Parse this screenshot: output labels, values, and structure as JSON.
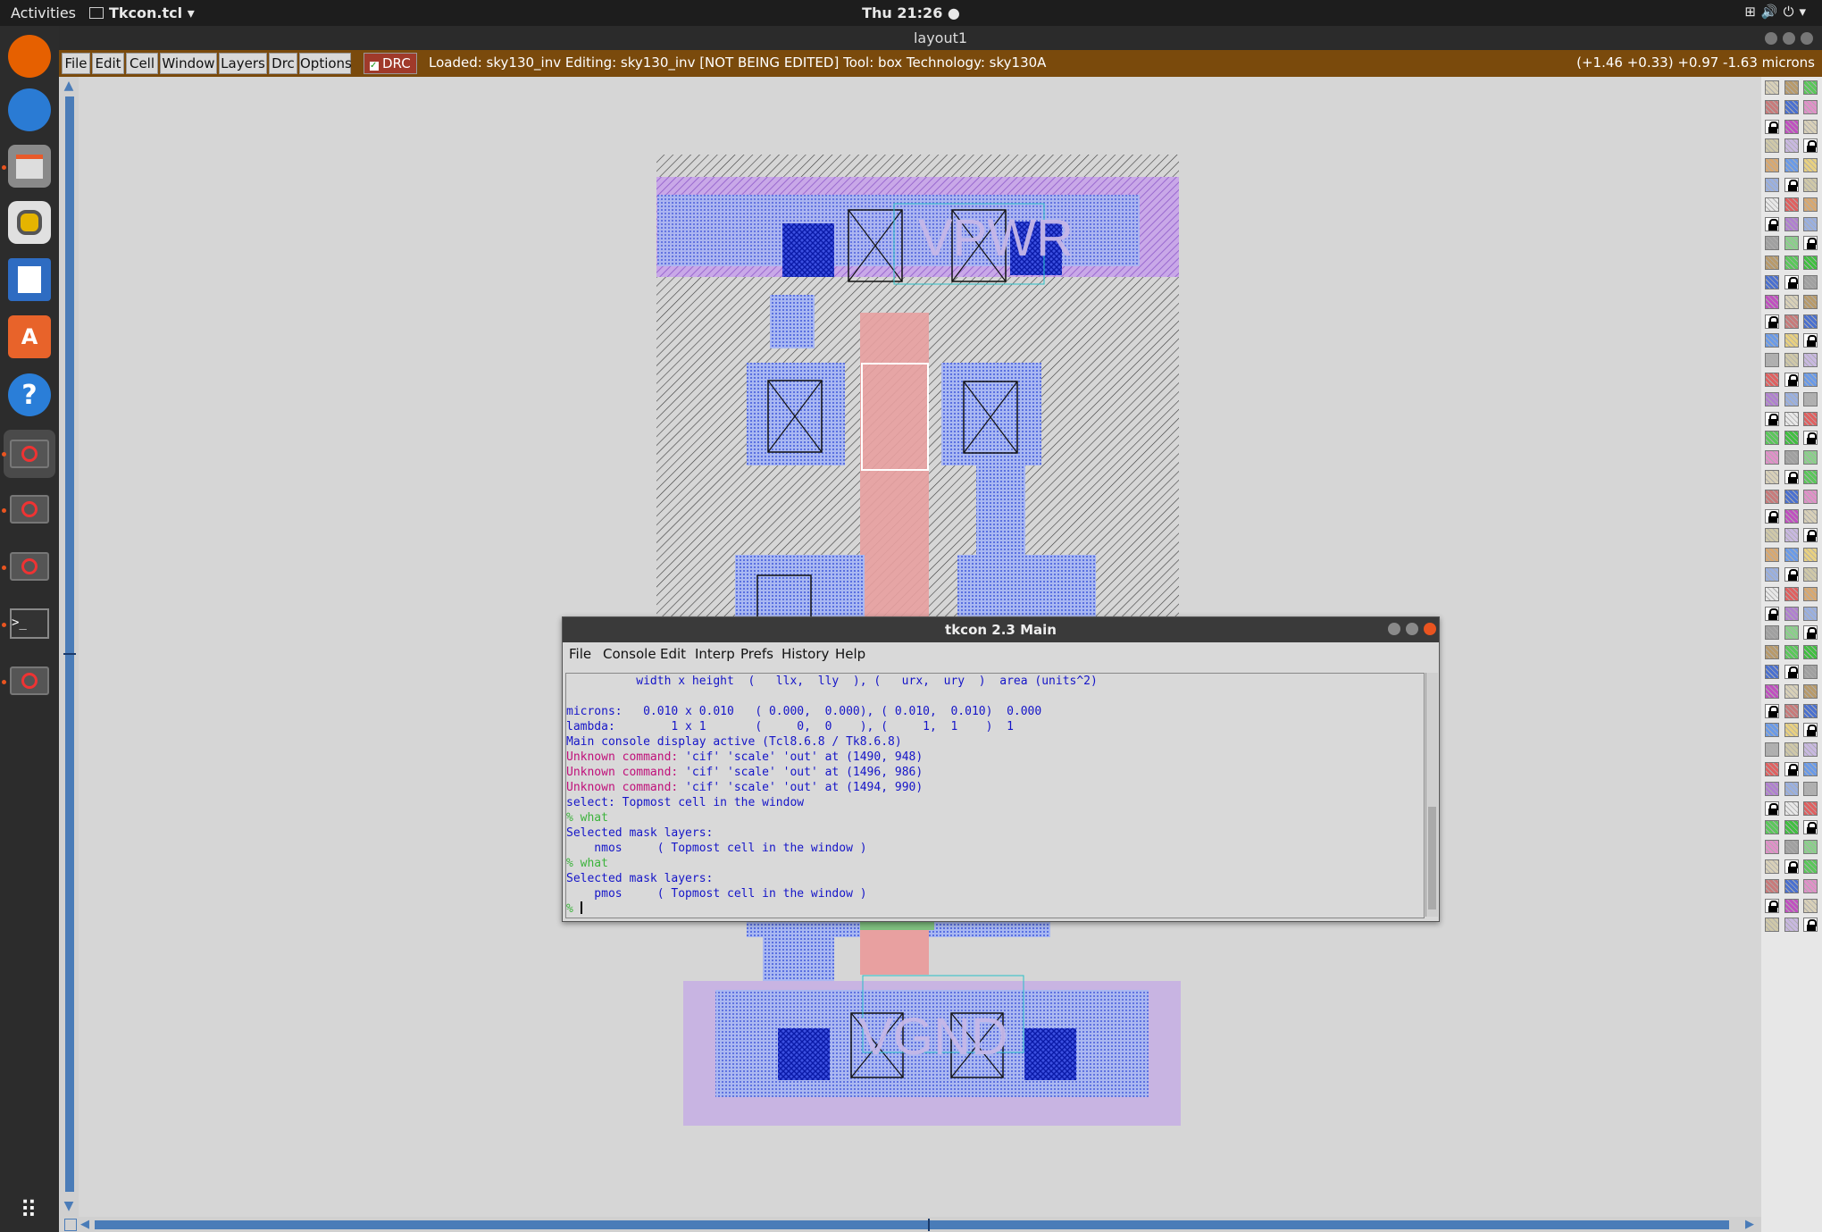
{
  "topbar": {
    "activities": "Activities",
    "app_menu": "Tkcon.tcl",
    "clock": "Thu 21:26",
    "tray_icons": [
      "network-icon",
      "volume-icon",
      "power-icon"
    ]
  },
  "dock": {
    "items": [
      "firefox-icon",
      "thunderbird-icon",
      "files-icon",
      "rhythmbox-icon",
      "writer-icon",
      "software-icon",
      "help-icon",
      "no-entry-app-icon",
      "no-entry-app-icon",
      "no-entry-app-icon",
      "terminal-icon",
      "no-entry-app-icon"
    ],
    "grid": "show-applications-icon"
  },
  "magic": {
    "window_title": "layout1",
    "menu": [
      "File",
      "Edit",
      "Cell",
      "Window",
      "Layers",
      "Drc",
      "Options"
    ],
    "drc_label": "DRC",
    "status": "Loaded: sky130_inv Editing: sky130_inv [NOT BEING EDITED] Tool: box  Technology: sky130A",
    "coords": "(+1.46 +0.33) +0.97 -1.63 microns"
  },
  "layout": {
    "label_top": "VPWR",
    "label_bottom": "VGND"
  },
  "tkcon": {
    "title": "tkcon 2.3 Main",
    "menu": [
      "File",
      "Console",
      "Edit",
      "Interp",
      "Prefs",
      "History",
      "Help"
    ],
    "lines": [
      {
        "t": "          width x height  (   llx,  lly  ), (   urx,  ury  )  area (units^2)",
        "c": "blue"
      },
      {
        "t": "",
        "c": "blue"
      },
      {
        "t": "microns:   0.010 x 0.010   ( 0.000,  0.000), ( 0.010,  0.010)  0.000",
        "c": "blue"
      },
      {
        "t": "lambda:        1 x 1       (     0,  0    ), (     1,  1    )  1",
        "c": "blue"
      },
      {
        "t": "Main console display active (Tcl8.6.8 / Tk8.6.8)",
        "c": "blue"
      },
      {
        "parts": [
          {
            "t": "Unknown command: ",
            "c": "mag"
          },
          {
            "t": "'cif' 'scale' 'out' at (1490, 948)",
            "c": "blue"
          }
        ]
      },
      {
        "parts": [
          {
            "t": "Unknown command: ",
            "c": "mag"
          },
          {
            "t": "'cif' 'scale' 'out' at (1496, 986)",
            "c": "blue"
          }
        ]
      },
      {
        "parts": [
          {
            "t": "Unknown command: ",
            "c": "mag"
          },
          {
            "t": "'cif' 'scale' 'out' at (1494, 990)",
            "c": "blue"
          }
        ]
      },
      {
        "t": "select: Topmost cell in the window",
        "c": "blue"
      },
      {
        "t": "% what",
        "c": "grn"
      },
      {
        "t": "Selected mask layers:",
        "c": "blue"
      },
      {
        "t": "    nmos     ( Topmost cell in the window )",
        "c": "blue"
      },
      {
        "t": "% what",
        "c": "grn"
      },
      {
        "t": "Selected mask layers:",
        "c": "blue"
      },
      {
        "t": "    pmos     ( Topmost cell in the window )",
        "c": "blue"
      },
      {
        "t": "% ",
        "c": "grn",
        "cursor": true
      }
    ]
  },
  "colors": {
    "menubar_bg": "#7a4a0c",
    "metal1": "#8a9cf0",
    "poly": "#e58a8a",
    "nwell": "#b97ad8",
    "diff": "#8ab0e8"
  }
}
